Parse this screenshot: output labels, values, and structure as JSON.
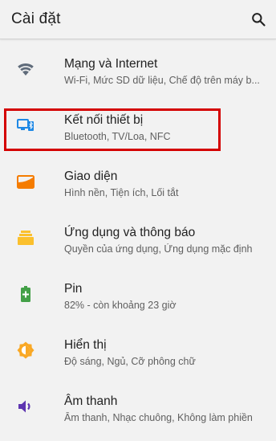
{
  "header": {
    "title": "Cài đặt",
    "search_icon": "search-icon"
  },
  "items": [
    {
      "title": "Mạng và Internet",
      "subtitle": "Wi-Fi, Mức SD dữ liệu, Chế độ trên máy b...",
      "icon": "wifi-icon",
      "color": "#5f6b7a"
    },
    {
      "title": "Kết nối thiết bị",
      "subtitle": "Bluetooth, TV/Loa, NFC",
      "icon": "connected-devices-icon",
      "color": "#1e88e5"
    },
    {
      "title": "Giao diện",
      "subtitle": "Hình nền, Tiện ích, Lối tắt",
      "icon": "wallpaper-icon",
      "color": "#f57c00"
    },
    {
      "title": "Ứng dụng và thông báo",
      "subtitle": "Quyền của ứng dụng, Ứng dụng mặc định",
      "icon": "apps-icon",
      "color": "#fbc02d"
    },
    {
      "title": "Pin",
      "subtitle": "82% - còn khoảng 23 giờ",
      "icon": "battery-icon",
      "color": "#43a047"
    },
    {
      "title": "Hiển thị",
      "subtitle": "Độ sáng, Ngủ, Cỡ phông chữ",
      "icon": "brightness-icon",
      "color": "#f9a825"
    },
    {
      "title": "Âm thanh",
      "subtitle": "Âm thanh, Nhạc chuông, Không làm phiền",
      "icon": "volume-icon",
      "color": "#5e35b1"
    }
  ],
  "highlight": {
    "target": "Kết nối thiết bị",
    "color": "#d40000"
  }
}
